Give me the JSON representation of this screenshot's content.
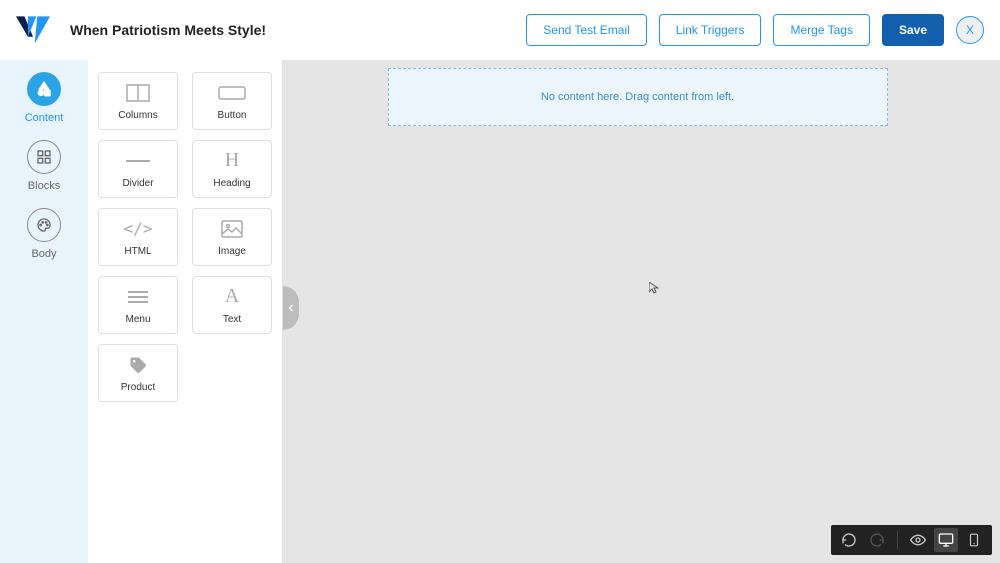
{
  "header": {
    "title": "When Patriotism Meets Style!",
    "buttons": {
      "send_test": "Send Test Email",
      "link_triggers": "Link Triggers",
      "merge_tags": "Merge Tags",
      "save": "Save",
      "close": "X"
    }
  },
  "rail": {
    "items": [
      {
        "label": "Content",
        "icon": "shapes-icon",
        "active": true
      },
      {
        "label": "Blocks",
        "icon": "grid-icon",
        "active": false
      },
      {
        "label": "Body",
        "icon": "palette-icon",
        "active": false
      }
    ]
  },
  "tools": {
    "items": [
      {
        "label": "Columns",
        "icon": "columns-icon"
      },
      {
        "label": "Button",
        "icon": "button-icon"
      },
      {
        "label": "Divider",
        "icon": "divider-icon"
      },
      {
        "label": "Heading",
        "icon": "heading-icon"
      },
      {
        "label": "HTML",
        "icon": "code-icon"
      },
      {
        "label": "Image",
        "icon": "image-icon"
      },
      {
        "label": "Menu",
        "icon": "menu-icon"
      },
      {
        "label": "Text",
        "icon": "text-icon"
      },
      {
        "label": "Product",
        "icon": "tag-icon"
      }
    ]
  },
  "canvas": {
    "dropzone_text": "No content here. Drag content from left."
  },
  "collapse": {
    "glyph": "‹"
  },
  "bottombar": {
    "items": [
      {
        "name": "undo-icon"
      },
      {
        "name": "redo-icon"
      },
      {
        "name": "preview-icon"
      },
      {
        "name": "desktop-icon"
      },
      {
        "name": "mobile-icon"
      }
    ]
  }
}
